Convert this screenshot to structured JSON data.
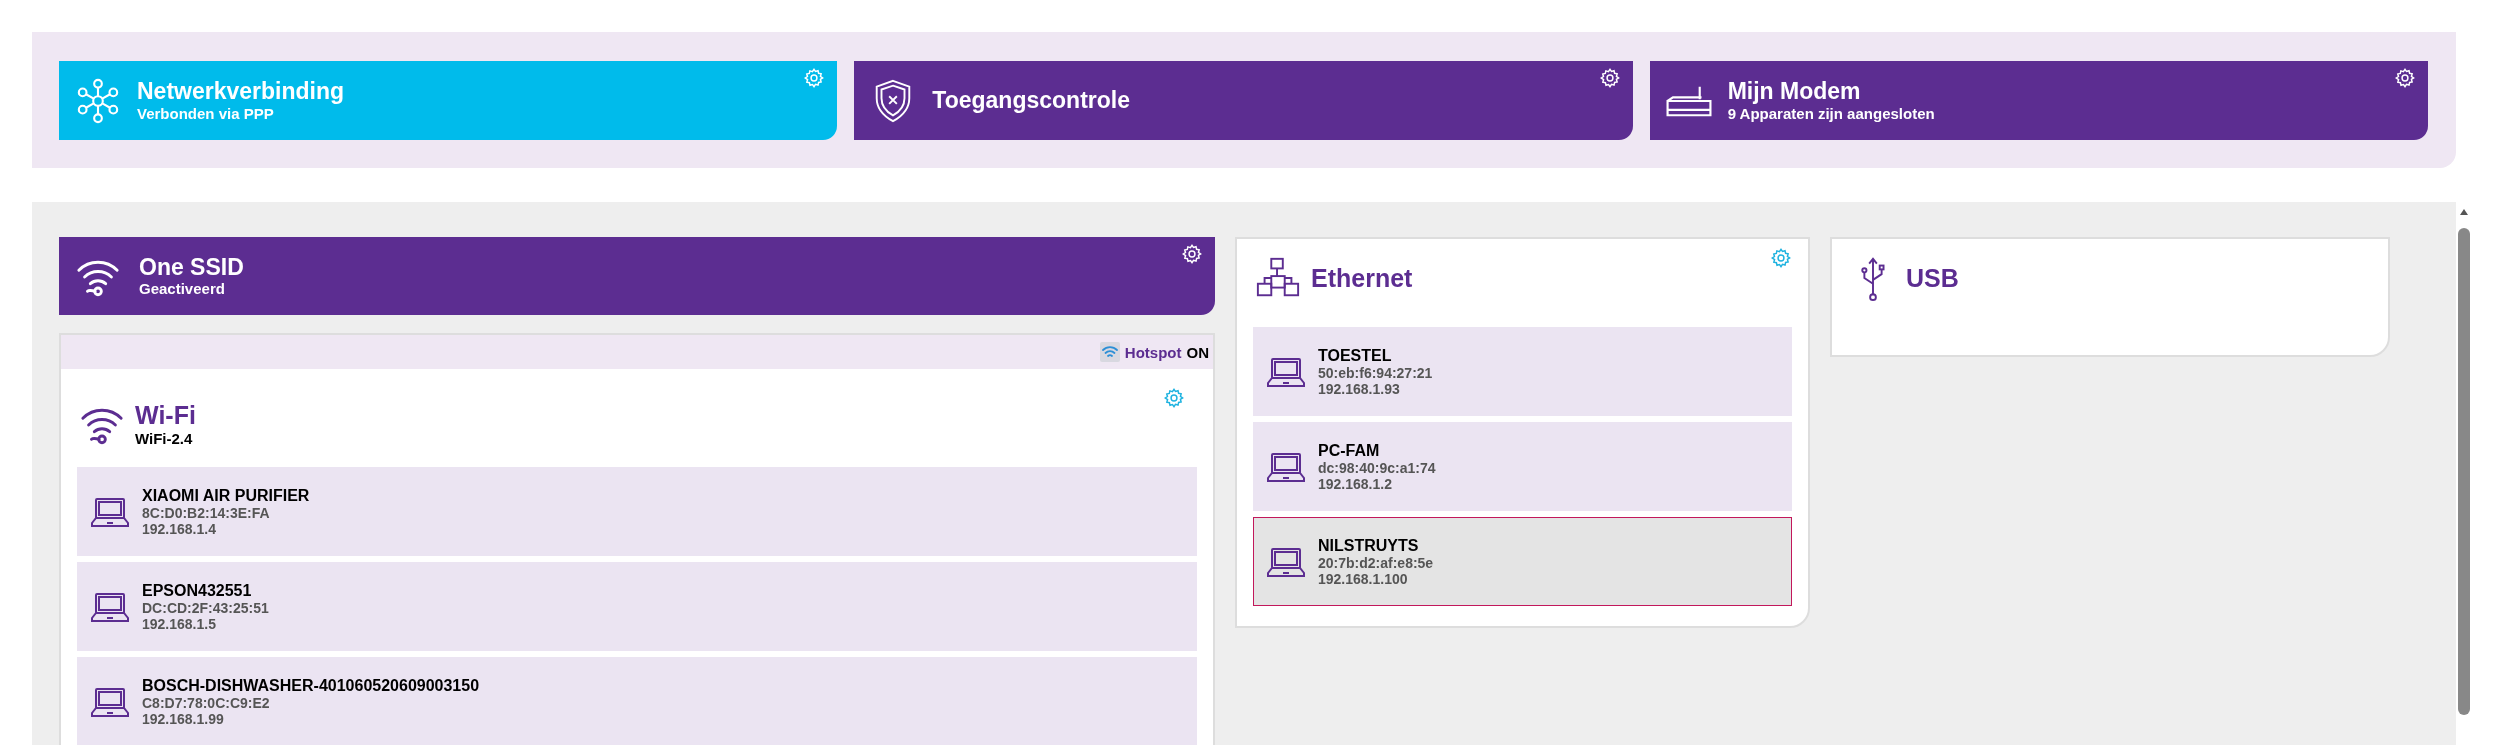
{
  "tiles": [
    {
      "title": "Netwerkverbinding",
      "subtitle": "Verbonden via PPP",
      "kind": "network",
      "color": "#00bbeb"
    },
    {
      "title": "Toegangscontrole",
      "kind": "shield",
      "color": "#5c2d91"
    },
    {
      "title": "Mijn Modem",
      "subtitle": "9 Apparaten zijn aangesloten",
      "kind": "modem",
      "color": "#5c2d91"
    }
  ],
  "ssid": {
    "title": "One SSID",
    "subtitle": "Geactiveerd"
  },
  "hotspot": {
    "label": "Hotspot",
    "state": "ON"
  },
  "wifi": {
    "title": "Wi-Fi",
    "subtitle": "WiFi-2.4",
    "devices": [
      {
        "name": "XIAOMI AIR PURIFIER",
        "mac": "8C:D0:B2:14:3E:FA",
        "ip": "192.168.1.4",
        "selected": false
      },
      {
        "name": "EPSON432551",
        "mac": "DC:CD:2F:43:25:51",
        "ip": "192.168.1.5",
        "selected": false
      },
      {
        "name": "BOSCH-DISHWASHER-401060520609003150",
        "mac": "C8:D7:78:0C:C9:E2",
        "ip": "192.168.1.99",
        "selected": false
      }
    ]
  },
  "interfaces": [
    {
      "title": "Ethernet",
      "kind": "ethernet",
      "settings": true,
      "devices": [
        {
          "name": "TOESTEL",
          "mac": "50:eb:f6:94:27:21",
          "ip": "192.168.1.93",
          "selected": false
        },
        {
          "name": "PC-FAM",
          "mac": "dc:98:40:9c:a1:74",
          "ip": "192.168.1.2",
          "selected": false
        },
        {
          "name": "NILSTRUYTS",
          "mac": "20:7b:d2:af:e8:5e",
          "ip": "192.168.1.100",
          "selected": true
        }
      ]
    },
    {
      "title": "USB",
      "kind": "usb",
      "settings": false
    }
  ]
}
